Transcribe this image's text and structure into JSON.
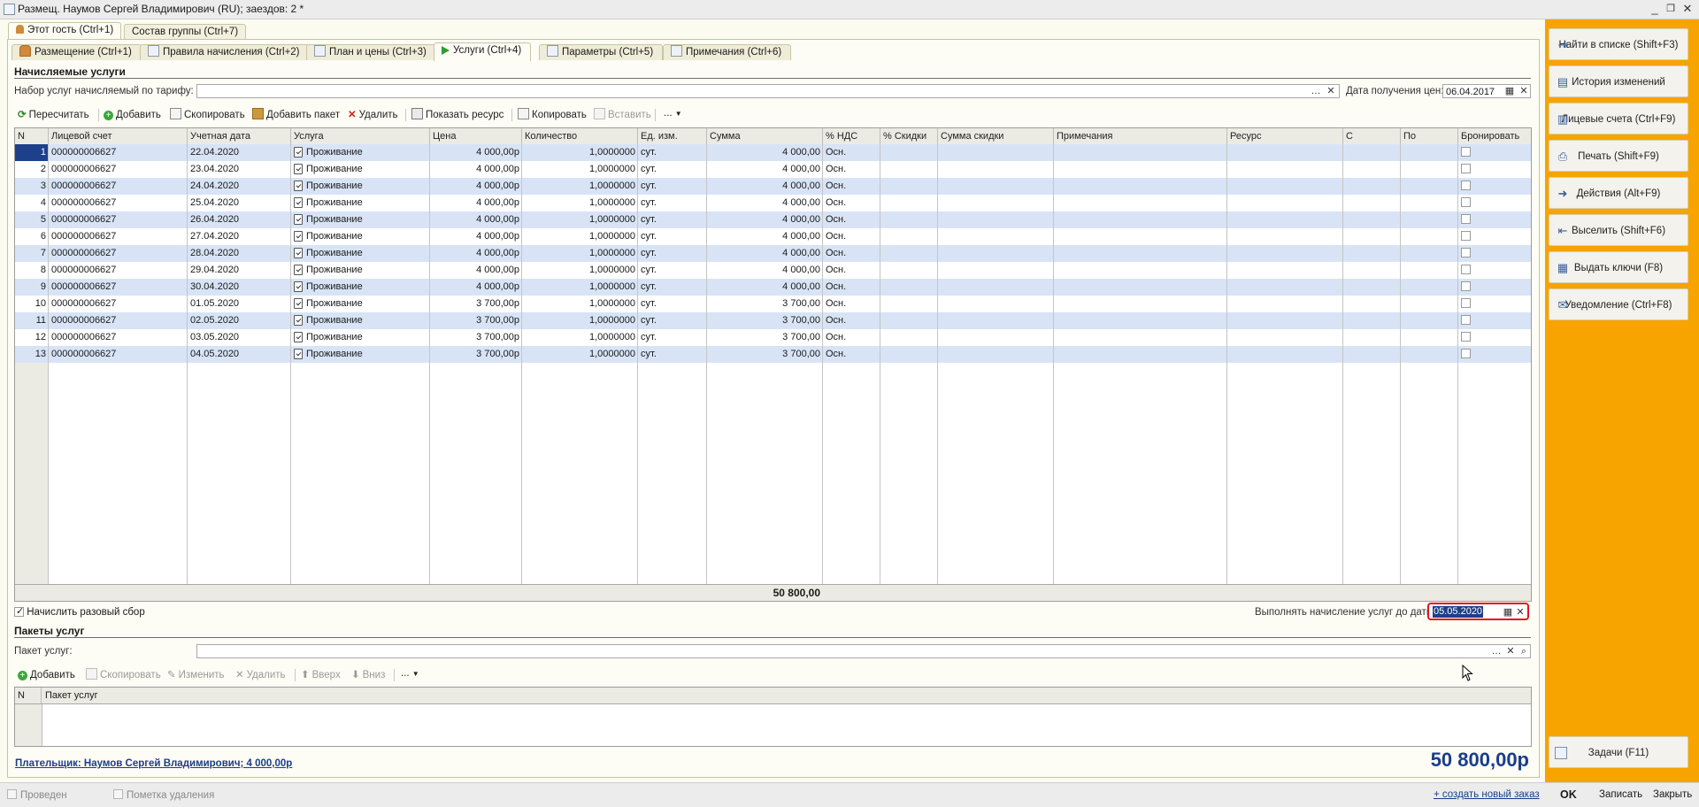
{
  "window": {
    "title": "Размещ. Наумов Сергей Владимирович (RU); заездов: 2 *",
    "controls": {
      "minimize": "_",
      "restore": "❐",
      "close": "✕"
    }
  },
  "top_tabs": [
    {
      "label": "Этот гость (Ctrl+1)",
      "icon": "user-icon",
      "active": true
    },
    {
      "label": "Состав группы (Ctrl+7)",
      "active": false
    }
  ],
  "sub_tabs": [
    {
      "label": "Размещение (Ctrl+1)",
      "icon": "user-icon"
    },
    {
      "label": "Правила начисления (Ctrl+2)",
      "icon": "rules-icon"
    },
    {
      "label": "План и цены (Ctrl+3)",
      "icon": "table-icon"
    },
    {
      "label": "Услуги (Ctrl+4)",
      "icon": "play-icon",
      "active": true
    },
    {
      "label": "Параметры (Ctrl+5)",
      "icon": "doc-icon"
    },
    {
      "label": "Примечания (Ctrl+6)",
      "icon": "note-icon"
    }
  ],
  "services": {
    "section_title": "Начисляемые услуги",
    "tariff_label": "Набор услуг начисляемый по тарифу:",
    "tariff_value": "",
    "price_date_label": "Дата получения цен:",
    "price_date_value": "06.04.2017",
    "toolbar": {
      "recalc": "Пересчитать",
      "add": "Добавить",
      "copy": "Скопировать",
      "add_package": "Добавить пакет",
      "delete": "Удалить",
      "show_resource": "Показать ресурс",
      "copy2": "Копировать",
      "paste": "Вставить",
      "more": "..."
    },
    "columns": [
      "N",
      "Лицевой счет",
      "Учетная дата",
      "Услуга",
      "Цена",
      "Количество",
      "Ед. изм.",
      "Сумма",
      "% НДС",
      "% Скидки",
      "Сумма скидки",
      "Примечания",
      "Ресурс",
      "С",
      "По",
      "Бронировать"
    ],
    "rows": [
      {
        "n": "1",
        "account": "000000006627",
        "date": "22.04.2020",
        "service": "Проживание",
        "price": "4 000,00р",
        "qty": "1,0000000",
        "unit": "сут.",
        "sum": "4 000,00",
        "vat": "Осн."
      },
      {
        "n": "2",
        "account": "000000006627",
        "date": "23.04.2020",
        "service": "Проживание",
        "price": "4 000,00р",
        "qty": "1,0000000",
        "unit": "сут.",
        "sum": "4 000,00",
        "vat": "Осн."
      },
      {
        "n": "3",
        "account": "000000006627",
        "date": "24.04.2020",
        "service": "Проживание",
        "price": "4 000,00р",
        "qty": "1,0000000",
        "unit": "сут.",
        "sum": "4 000,00",
        "vat": "Осн."
      },
      {
        "n": "4",
        "account": "000000006627",
        "date": "25.04.2020",
        "service": "Проживание",
        "price": "4 000,00р",
        "qty": "1,0000000",
        "unit": "сут.",
        "sum": "4 000,00",
        "vat": "Осн."
      },
      {
        "n": "5",
        "account": "000000006627",
        "date": "26.04.2020",
        "service": "Проживание",
        "price": "4 000,00р",
        "qty": "1,0000000",
        "unit": "сут.",
        "sum": "4 000,00",
        "vat": "Осн."
      },
      {
        "n": "6",
        "account": "000000006627",
        "date": "27.04.2020",
        "service": "Проживание",
        "price": "4 000,00р",
        "qty": "1,0000000",
        "unit": "сут.",
        "sum": "4 000,00",
        "vat": "Осн."
      },
      {
        "n": "7",
        "account": "000000006627",
        "date": "28.04.2020",
        "service": "Проживание",
        "price": "4 000,00р",
        "qty": "1,0000000",
        "unit": "сут.",
        "sum": "4 000,00",
        "vat": "Осн."
      },
      {
        "n": "8",
        "account": "000000006627",
        "date": "29.04.2020",
        "service": "Проживание",
        "price": "4 000,00р",
        "qty": "1,0000000",
        "unit": "сут.",
        "sum": "4 000,00",
        "vat": "Осн."
      },
      {
        "n": "9",
        "account": "000000006627",
        "date": "30.04.2020",
        "service": "Проживание",
        "price": "4 000,00р",
        "qty": "1,0000000",
        "unit": "сут.",
        "sum": "4 000,00",
        "vat": "Осн."
      },
      {
        "n": "10",
        "account": "000000006627",
        "date": "01.05.2020",
        "service": "Проживание",
        "price": "3 700,00р",
        "qty": "1,0000000",
        "unit": "сут.",
        "sum": "3 700,00",
        "vat": "Осн."
      },
      {
        "n": "11",
        "account": "000000006627",
        "date": "02.05.2020",
        "service": "Проживание",
        "price": "3 700,00р",
        "qty": "1,0000000",
        "unit": "сут.",
        "sum": "3 700,00",
        "vat": "Осн."
      },
      {
        "n": "12",
        "account": "000000006627",
        "date": "03.05.2020",
        "service": "Проживание",
        "price": "3 700,00р",
        "qty": "1,0000000",
        "unit": "сут.",
        "sum": "3 700,00",
        "vat": "Осн."
      },
      {
        "n": "13",
        "account": "000000006627",
        "date": "04.05.2020",
        "service": "Проживание",
        "price": "3 700,00р",
        "qty": "1,0000000",
        "unit": "сут.",
        "sum": "3 700,00",
        "vat": "Осн."
      }
    ],
    "total_sum": "50 800,00",
    "one_time_fee_label": "Начислить разовый сбор",
    "one_time_fee_checked": true,
    "charge_until_label": "Выполнять начисление услуг до даты:",
    "charge_until_value": "05.05.2020"
  },
  "packages": {
    "section_title": "Пакеты услуг",
    "package_label": "Пакет услуг:",
    "package_value": "",
    "toolbar": {
      "add": "Добавить",
      "copy": "Скопировать",
      "edit": "Изменить",
      "delete": "Удалить",
      "up": "Вверх",
      "down": "Вниз",
      "more": "..."
    },
    "columns": [
      "N",
      "Пакет услуг"
    ]
  },
  "payer_link": "Плательщик: Наумов Сергей Владимирович; 4 000,00р",
  "grand_total": "50 800,00р",
  "right_panel": {
    "buttons": [
      {
        "label": "Найти в списке (Shift+F3)",
        "icon": "find-icon"
      },
      {
        "label": "История изменений",
        "icon": "history-icon"
      },
      {
        "label": "Лицевые счета (Ctrl+F9)",
        "icon": "accounts-icon"
      },
      {
        "label": "Печать (Shift+F9)",
        "icon": "print-icon"
      },
      {
        "label": "Действия (Alt+F9)",
        "icon": "actions-icon"
      },
      {
        "label": "Выселить (Shift+F6)",
        "icon": "checkout-icon"
      },
      {
        "label": "Выдать ключи (F8)",
        "icon": "keys-icon"
      },
      {
        "label": "Уведомление (Ctrl+F8)",
        "icon": "notify-icon"
      }
    ],
    "tasks_button": "Задачи (F11)"
  },
  "status_bar": {
    "posted_label": "Проведен",
    "deletion_mark_label": "Пометка удаления",
    "new_order_link": "+ создать новый заказ",
    "ok": "OK",
    "save": "Записать",
    "close": "Закрыть"
  },
  "colors": {
    "accent_panel": "#f7a300",
    "row_alt": "#d8e4f6",
    "highlight_border": "#e0141e",
    "link": "#1a3d8a"
  }
}
